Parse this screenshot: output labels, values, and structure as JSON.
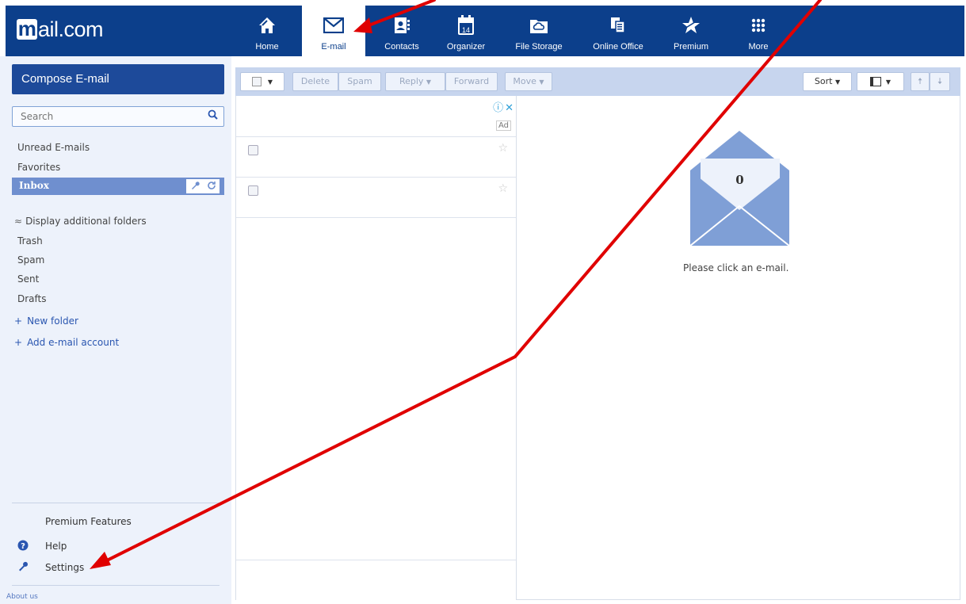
{
  "brand": {
    "logo_m": "m",
    "logo_rest": "ail.com"
  },
  "nav": [
    {
      "id": "home",
      "label": "Home",
      "icon": "home-icon"
    },
    {
      "id": "email",
      "label": "E-mail",
      "icon": "envelope-icon",
      "active": true
    },
    {
      "id": "contacts",
      "label": "Contacts",
      "icon": "contacts-icon"
    },
    {
      "id": "organizer",
      "label": "Organizer",
      "icon": "calendar-icon",
      "calendar_day": "14"
    },
    {
      "id": "filestorage",
      "label": "File Storage",
      "icon": "cloud-folder-icon"
    },
    {
      "id": "onlineoffice",
      "label": "Online Office",
      "icon": "documents-icon"
    },
    {
      "id": "premium",
      "label": "Premium",
      "icon": "star-icon"
    },
    {
      "id": "more",
      "label": "More",
      "icon": "grid-dots-icon"
    }
  ],
  "sidebar": {
    "compose": "Compose E-mail",
    "search_placeholder": "Search",
    "folders_top": [
      "Unread E-mails",
      "Favorites"
    ],
    "inbox": "Inbox",
    "display_additional": "Display additional folders",
    "folders": [
      "Trash",
      "Spam",
      "Sent",
      "Drafts"
    ],
    "new_folder": "New folder",
    "add_account": "Add e-mail account",
    "premium_features": "Premium Features",
    "help": "Help",
    "settings": "Settings",
    "about": "About us"
  },
  "toolbar": {
    "delete": "Delete",
    "spam": "Spam",
    "reply": "Reply",
    "forward": "Forward",
    "move": "Move",
    "sort": "Sort"
  },
  "list": {
    "ad_label": "Ad"
  },
  "preview": {
    "count": "0",
    "empty_message": "Please click an e-mail."
  },
  "colors": {
    "nav_bg": "#0c3f8b",
    "accent": "#1d4a9a",
    "arrow": "#e00000",
    "envelope": "#7f9fd6"
  }
}
